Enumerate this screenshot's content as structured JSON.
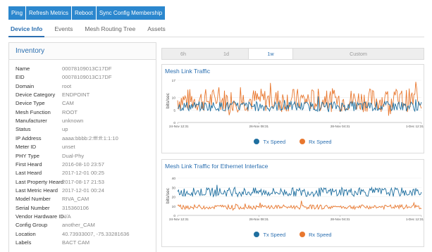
{
  "toolbar": {
    "buttons": [
      "Ping",
      "Refresh Metrics",
      "Reboot",
      "Sync Config Membership"
    ]
  },
  "tabs": [
    "Device Info",
    "Events",
    "Mesh Routing Tree",
    "Assets"
  ],
  "active_tab": "Device Info",
  "inventory": {
    "title": "Inventory",
    "rows": [
      {
        "key": "Name",
        "value": "00078109013C17DF"
      },
      {
        "key": "EID",
        "value": "00078109013C17DF"
      },
      {
        "key": "Domain",
        "value": "root"
      },
      {
        "key": "Device Category",
        "value": "ENDPOINT"
      },
      {
        "key": "Device Type",
        "value": "CAM"
      },
      {
        "key": "Mesh Function",
        "value": "ROOT"
      },
      {
        "key": "Manufacturer",
        "value": "unknown"
      },
      {
        "key": "Status",
        "value": "up"
      },
      {
        "key": "IP Address",
        "value": "aaaa:bbbb:2:fff:ff:1:1:10"
      },
      {
        "key": "Meter ID",
        "value": "unset"
      },
      {
        "key": "PHY Type",
        "value": "Dual-Phy"
      },
      {
        "key": "First Heard",
        "value": "2016-08-10 23:57"
      },
      {
        "key": "Last Heard",
        "value": "2017-12-01 00:25"
      },
      {
        "key": "Last Property Heard",
        "value": "2017-08-17 21:53"
      },
      {
        "key": "Last Metric Heard",
        "value": "2017-12-01 00:24"
      },
      {
        "key": "Model Number",
        "value": "RIVA_CAM"
      },
      {
        "key": "Serial Number",
        "value": "315360106"
      },
      {
        "key": "Vendor Hardware ID",
        "value": "N/A"
      },
      {
        "key": "Config Group",
        "value": "another_CAM"
      },
      {
        "key": "Location",
        "value": "40.73933007, -75.33281636"
      },
      {
        "key": "Labels",
        "value": "BACT CAM"
      }
    ]
  },
  "time_range": {
    "options": [
      "6h",
      "1d",
      "1w",
      "Custom"
    ],
    "selected": "1w"
  },
  "colors": {
    "accent": "#2b6fb0",
    "button": "#2b87ce",
    "tx": "#1f6f9f",
    "rx": "#e8772e"
  },
  "chart_data": [
    {
      "type": "line",
      "title": "Mesh Link Traffic",
      "ylabel": "bits/sec",
      "ylim": [
        0,
        17
      ],
      "yticks": [
        "0",
        "5",
        "10",
        "17"
      ],
      "xticks": [
        "24-Nov 12:31",
        "26-Nov 08:31",
        "28-Nov 04:31",
        "1-Dec 12:31"
      ],
      "grid": true,
      "legend": "bottom",
      "series": [
        {
          "name": "Tx Speed",
          "color": "#1f6f9f",
          "baseline": 6.5,
          "spread": 2.5
        },
        {
          "name": "Rx Speed",
          "color": "#e8772e",
          "baseline": 9,
          "spread": 6
        }
      ]
    },
    {
      "type": "line",
      "title": "Mesh Link Traffic for Ethernet Interface",
      "ylabel": "bits/sec",
      "ylim": [
        0,
        40
      ],
      "yticks": [
        "0",
        "10",
        "20",
        "30",
        "40"
      ],
      "xticks": [
        "24-Nov 12:31",
        "26-Nov 08:31",
        "28-Nov 04:31",
        "1-Dec 12:31"
      ],
      "grid": true,
      "legend": "bottom",
      "series": [
        {
          "name": "Tx Speed",
          "color": "#1f6f9f",
          "baseline": 25,
          "spread": 6
        },
        {
          "name": "Rx Speed",
          "color": "#e8772e",
          "baseline": 9,
          "spread": 3
        }
      ]
    }
  ]
}
